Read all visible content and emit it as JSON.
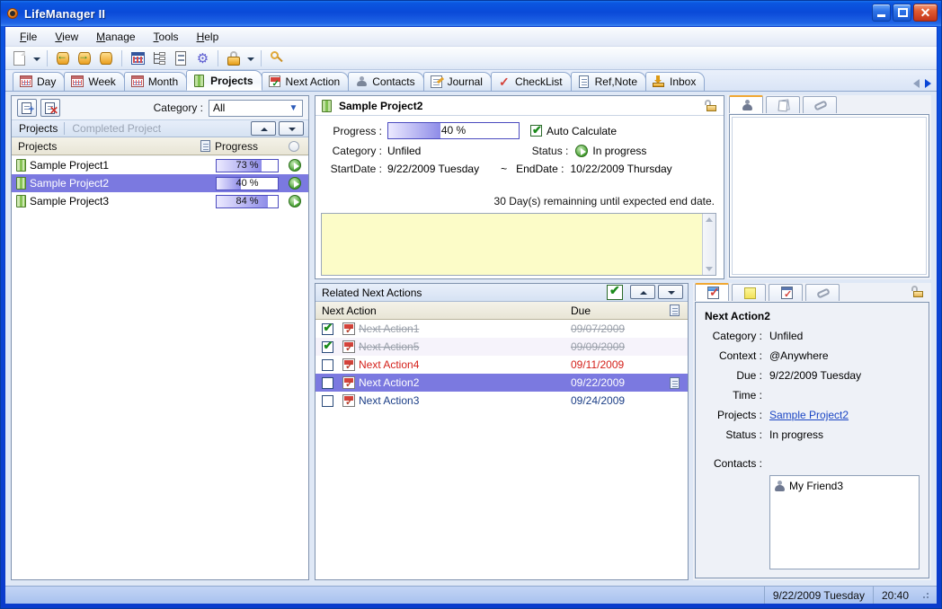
{
  "window": {
    "title": "LifeManager II",
    "app_icon": "orange-circle-icon",
    "buttons": {
      "minimize": "–",
      "maximize": "□",
      "close": "✕"
    }
  },
  "menu": [
    {
      "label": "File",
      "accel": "F"
    },
    {
      "label": "View",
      "accel": "V"
    },
    {
      "label": "Manage",
      "accel": "M"
    },
    {
      "label": "Tools",
      "accel": "T"
    },
    {
      "label": "Help",
      "accel": "H"
    }
  ],
  "toolbar": {
    "items": [
      {
        "name": "new-page-icon"
      },
      {
        "name": "new-page-dropdown-arrow"
      },
      {
        "name": "import-database-icon"
      },
      {
        "name": "export-database-icon"
      },
      {
        "name": "database-info-icon"
      },
      {
        "name": "calendar-icon"
      },
      {
        "name": "outline-tree-icon"
      },
      {
        "name": "list-icon"
      },
      {
        "name": "options-gear-icon"
      },
      {
        "name": "lock-icon"
      },
      {
        "name": "lock-dropdown-arrow"
      },
      {
        "name": "search-icon"
      }
    ]
  },
  "tabs": {
    "active": "Projects",
    "items": [
      {
        "label": "Day",
        "icon": "day-calendar-icon"
      },
      {
        "label": "Week",
        "icon": "week-calendar-icon"
      },
      {
        "label": "Month",
        "icon": "month-calendar-icon"
      },
      {
        "label": "Projects",
        "icon": "projects-book-icon"
      },
      {
        "label": "Next Action",
        "icon": "next-action-icon"
      },
      {
        "label": "Contacts",
        "icon": "contacts-person-icon"
      },
      {
        "label": "Journal",
        "icon": "journal-icon"
      },
      {
        "label": "CheckList",
        "icon": "checklist-check-icon"
      },
      {
        "label": "Ref,Note",
        "icon": "ref-note-icon"
      },
      {
        "label": "Inbox",
        "icon": "inbox-icon"
      }
    ],
    "nav": {
      "prev": "scroll-tabs-left",
      "next": "scroll-tabs-right"
    }
  },
  "projects_panel": {
    "new_project_button": "new-project-icon",
    "delete_project_button": "delete-project-icon",
    "category_label": "Category :",
    "category_value": "All",
    "subtabs": [
      {
        "label": "Projects",
        "active": true
      },
      {
        "label": "Completed Project",
        "active": false
      }
    ],
    "sort_up": "sort-ascending",
    "sort_down": "sort-descending",
    "columns": [
      "Projects",
      "doc-icon",
      "Progress",
      "status-circle-icon"
    ],
    "rows": [
      {
        "name": "Sample Project1",
        "progress": 73,
        "progress_label": "73 %",
        "status_icon": "in-progress-icon",
        "selected": false
      },
      {
        "name": "Sample Project2",
        "progress": 40,
        "progress_label": "40 %",
        "status_icon": "in-progress-icon",
        "selected": true
      },
      {
        "name": "Sample Project3",
        "progress": 84,
        "progress_label": "84 %",
        "status_icon": "in-progress-icon",
        "selected": false
      }
    ]
  },
  "project_detail": {
    "title": "Sample Project2",
    "icon": "projects-book-icon",
    "lock_icon": "unlocked-icon",
    "progress_label": "Progress :",
    "progress_value": 40,
    "progress_text": "40 %",
    "auto_calculate_label": "Auto Calculate",
    "auto_calculate_checked": true,
    "category_label": "Category :",
    "category_value": "Unfiled",
    "status_label": "Status :",
    "status_value": "In progress",
    "status_icon": "in-progress-icon",
    "startdate_label": "StartDate :",
    "startdate_value": "9/22/2009 Tuesday",
    "date_separator": "~",
    "enddate_label": "EndDate :",
    "enddate_value": "10/22/2009 Thursday",
    "days_remaining": "30 Day(s) remainning until expected end date.",
    "note_text": ""
  },
  "project_side_tabs": {
    "active_index": 0,
    "items": [
      {
        "icon": "contacts-person-icon"
      },
      {
        "icon": "pages-icon"
      },
      {
        "icon": "attachment-clip-icon"
      }
    ],
    "content": ""
  },
  "related_next_actions": {
    "header": "Related Next Actions",
    "show_completed_toggle": "checkmark-toggle",
    "sort_up": "sort-ascending",
    "sort_down": "sort-descending",
    "columns": [
      "Next Action",
      "Due",
      "doc-icon"
    ],
    "rows": [
      {
        "checked": true,
        "name": "Next Action1",
        "due": "09/07/2009",
        "state": "done",
        "has_note": false,
        "selected": false
      },
      {
        "checked": true,
        "name": "Next Action5",
        "due": "09/09/2009",
        "state": "done",
        "has_note": false,
        "selected": false
      },
      {
        "checked": false,
        "name": "Next Action4",
        "due": "09/11/2009",
        "state": "overdue",
        "has_note": false,
        "selected": false
      },
      {
        "checked": false,
        "name": "Next Action2",
        "due": "09/22/2009",
        "state": "normal",
        "has_note": true,
        "selected": true
      },
      {
        "checked": false,
        "name": "Next Action3",
        "due": "09/24/2009",
        "state": "normal",
        "has_note": false,
        "selected": false
      }
    ]
  },
  "next_action_detail": {
    "tabs": [
      {
        "icon": "checkbox-checked-icon",
        "active": true
      },
      {
        "icon": "yellow-note-icon",
        "active": false
      },
      {
        "icon": "checklist-icon",
        "active": false
      },
      {
        "icon": "attachment-clip-icon",
        "active": false
      }
    ],
    "lock_icon": "unlocked-icon",
    "title": "Next Action2",
    "category_label": "Category :",
    "category_value": "Unfiled",
    "context_label": "Context :",
    "context_value": "@Anywhere",
    "due_label": "Due :",
    "due_value": "9/22/2009 Tuesday",
    "time_label": "Time :",
    "time_value": "",
    "projects_label": "Projects :",
    "projects_value": "Sample Project2",
    "status_label": "Status :",
    "status_value": "In progress",
    "contacts_label": "Contacts :",
    "contacts": [
      {
        "name": "My Friend3",
        "icon": "contacts-person-icon"
      }
    ]
  },
  "statusbar": {
    "date": "9/22/2009 Tuesday",
    "time": "20:40",
    "grip": "resize-grip"
  },
  "colors": {
    "titlebar_blue": "#0a4ad8",
    "selection_purple": "#7b79e0",
    "progress_fill": "#8e8ce8",
    "note_yellow": "#fcfcc8",
    "grid_header": "#e8e5d6",
    "overdue_red": "#d4201a",
    "link_blue": "#1b46c4",
    "accent_orange": "#f0a732"
  }
}
